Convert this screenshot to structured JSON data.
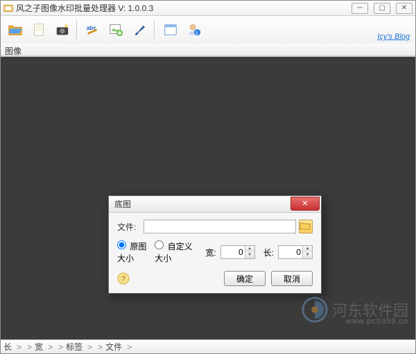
{
  "window": {
    "title": "风之子图像水印批量处理器  V: 1.0.0.3"
  },
  "toolbar": {
    "link_text": "Icy's Blog"
  },
  "section": {
    "label": "图像"
  },
  "dialog": {
    "title": "底图",
    "file_label": "文件:",
    "file_value": "",
    "radio_original": "原图大小",
    "radio_custom": "自定义大小",
    "width_label": "宽:",
    "width_value": "0",
    "height_label": "长:",
    "height_value": "0",
    "ok_label": "确定",
    "cancel_label": "取消"
  },
  "statusbar": {
    "seg1": "长",
    "seg2": "宽",
    "seg3": "标签",
    "seg4": "文件"
  },
  "watermark": {
    "text": "河东软件园",
    "url": "www.pc0359.cn"
  }
}
